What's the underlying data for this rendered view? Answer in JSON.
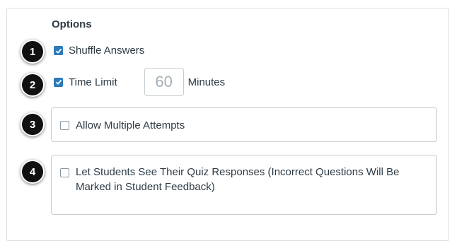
{
  "options": {
    "title": "Options",
    "shuffle_answers": {
      "label": "Shuffle Answers",
      "checked": true,
      "badge": "1"
    },
    "time_limit": {
      "label": "Time Limit",
      "checked": true,
      "value": "60",
      "unit": "Minutes",
      "badge": "2"
    },
    "multiple_attempts": {
      "label": "Allow Multiple Attempts",
      "checked": false,
      "badge": "3"
    },
    "see_responses": {
      "label_line1": "Let Students See Their Quiz Responses (Incorrect Questions Will Be",
      "label_line2": "Marked in Student Feedback)",
      "checked": false,
      "badge": "4"
    }
  },
  "colors": {
    "checkbox_accent": "#2b7abc",
    "text": "#2d3b45",
    "badge": "#111111"
  }
}
